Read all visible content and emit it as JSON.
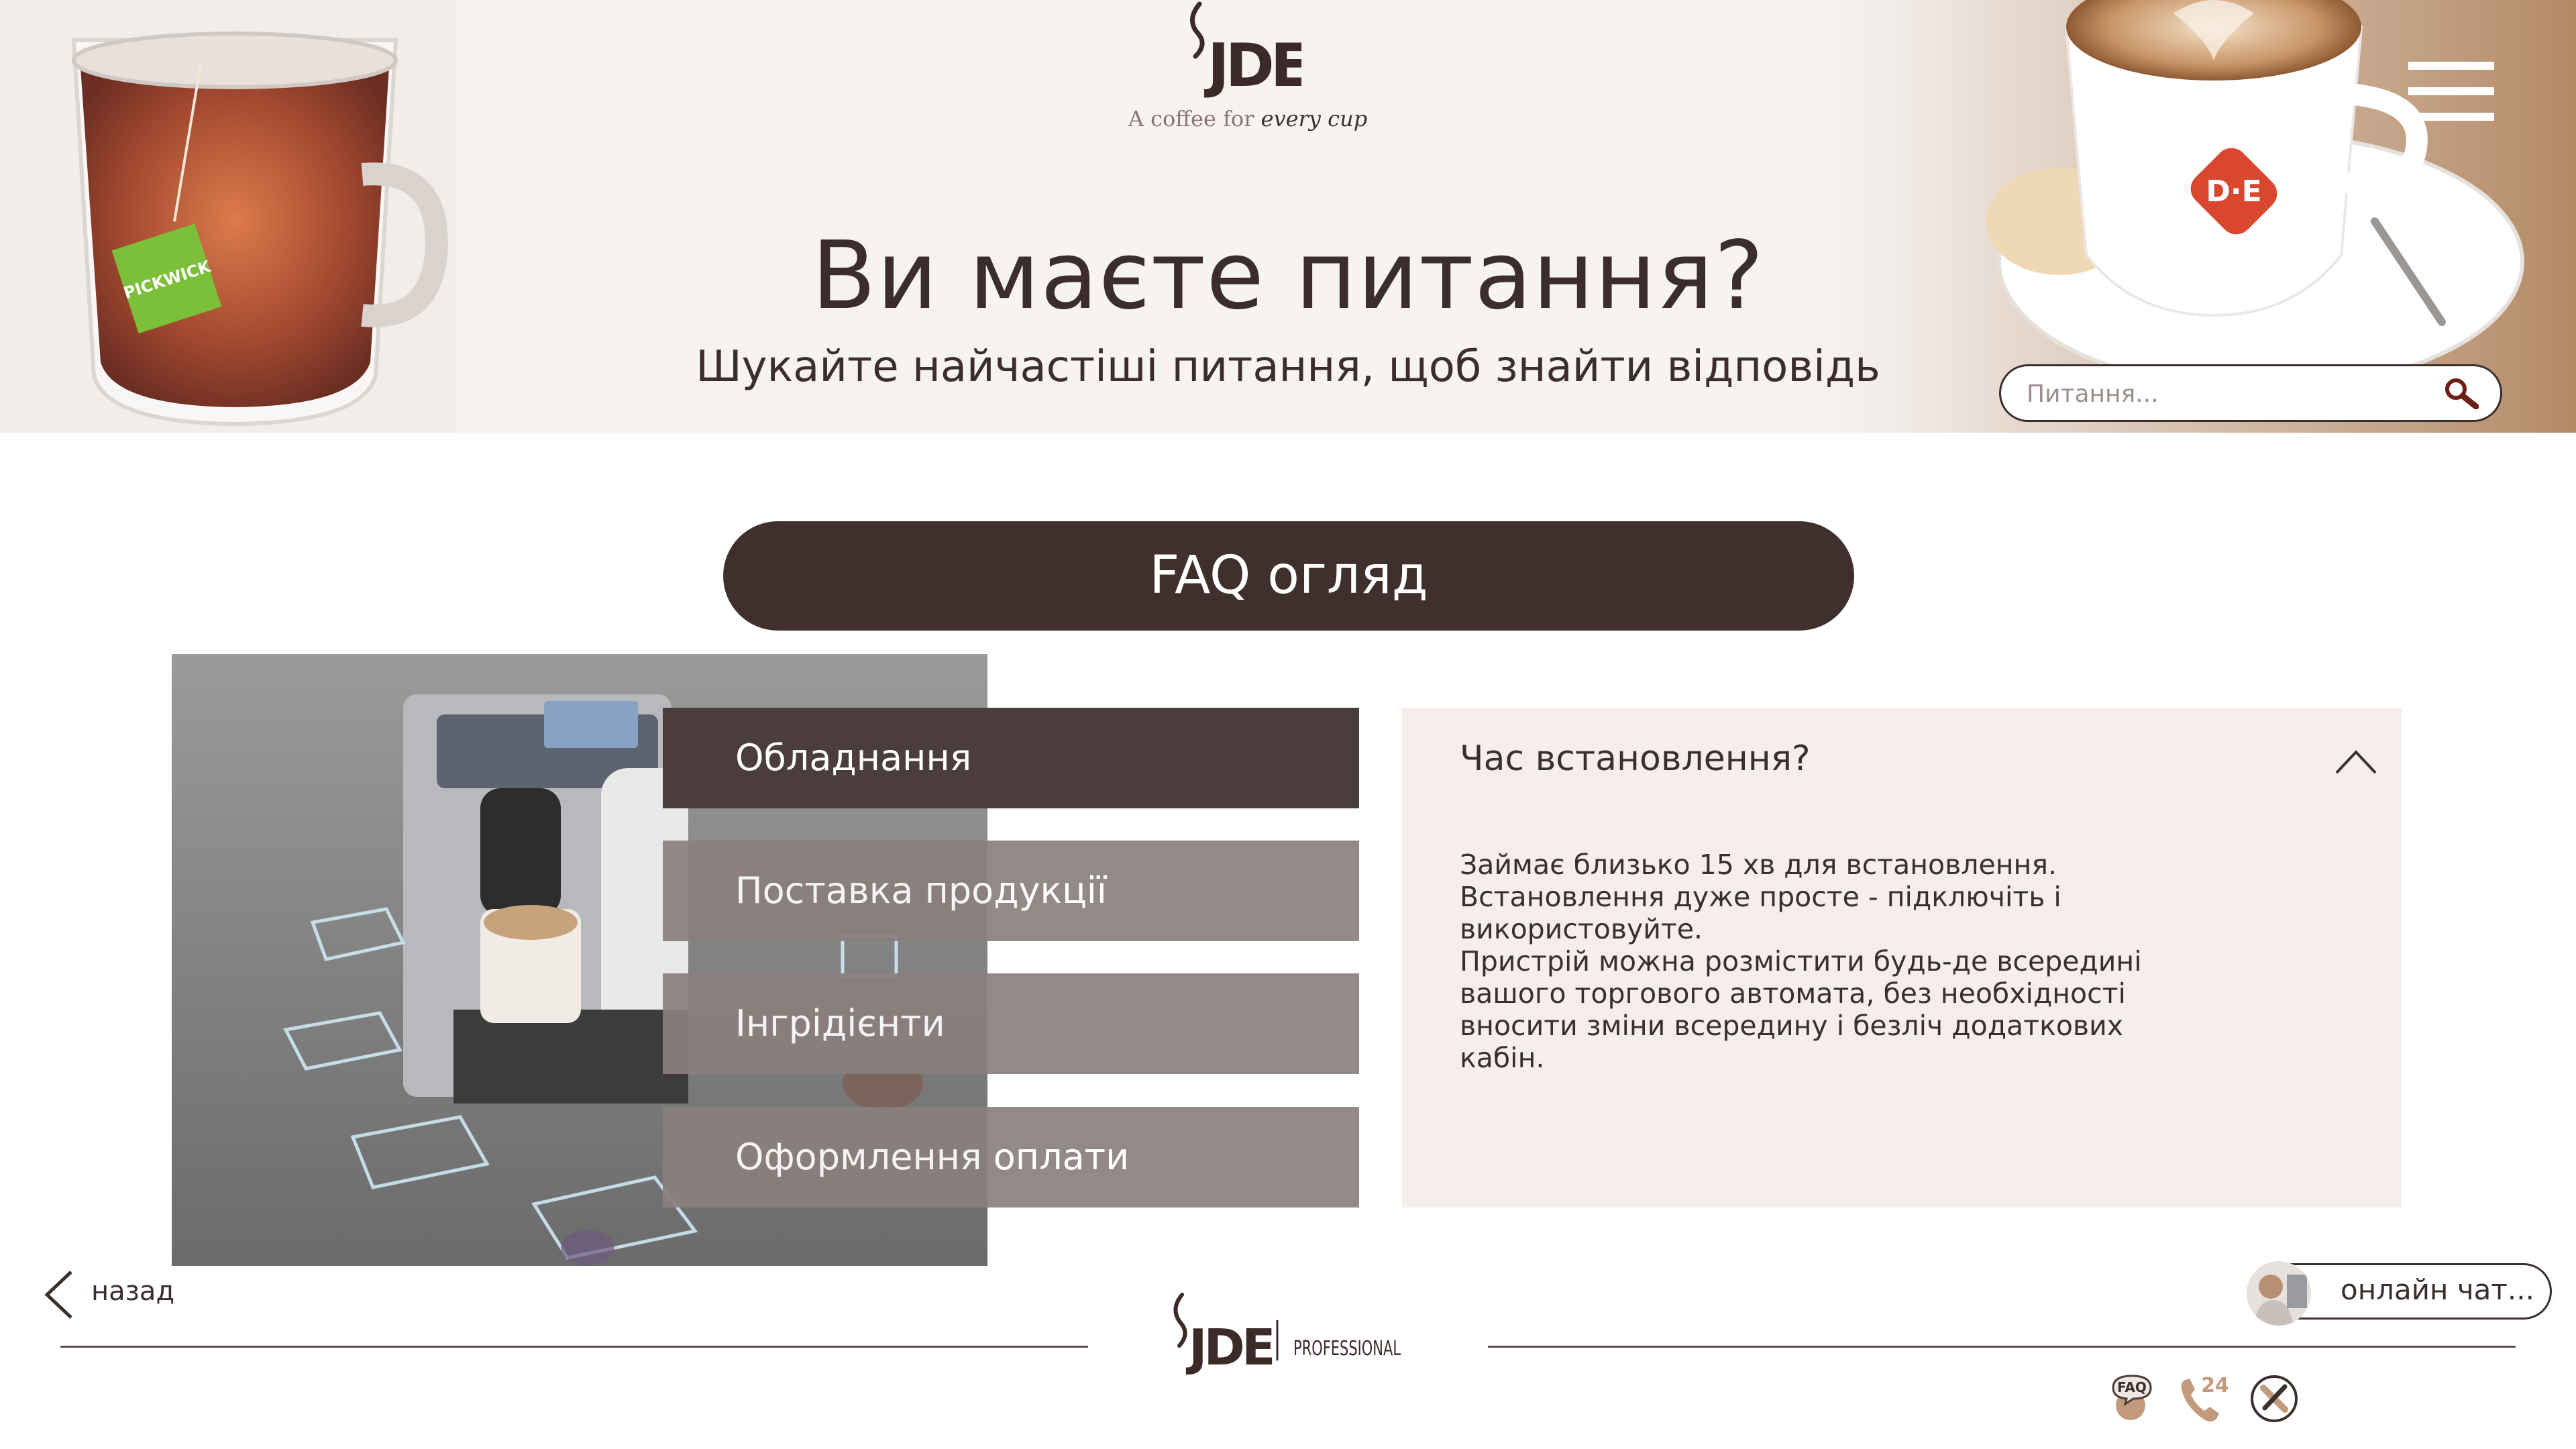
{
  "header": {
    "brand_tagline_plain": "A coffee for",
    "brand_tagline_emph": "every cup",
    "headline": "Ви маєте питання?",
    "subheadline": "Шукайте найчастіші питання, щоб знайти відповідь",
    "tea_tag_text": "PICKWICK",
    "cup_logo_text": "D·E"
  },
  "search": {
    "placeholder": "Питання..."
  },
  "faq_button": {
    "label": "FAQ огляд"
  },
  "categories": [
    {
      "label": "Обладнання",
      "color": "#4b3d3b"
    },
    {
      "label": "Поставка продукції",
      "color": "#8a7f7d"
    },
    {
      "label": "Інгрідієнти",
      "color": "#8a7f7d"
    },
    {
      "label": "Оформлення оплати",
      "color": "#8a7f7d"
    }
  ],
  "answer": {
    "question": "Час встановлення?",
    "lines": [
      "Займає близько 15 хв для встановлення.",
      "Встановлення дуже просте - підключіть і",
      "використовуйте.",
      "Пристрій можна розмістити будь-де всередині",
      "вашого торгового автомата, без необхідності",
      "вносити зміни всередину і безліч додаткових",
      "кабін."
    ]
  },
  "footer": {
    "back_label": "назад",
    "brand_sub": "PROFESSIONAL",
    "chat_label": "онлайн чат...",
    "icons": [
      {
        "name": "faq-icon",
        "label": "FAQ"
      },
      {
        "name": "phone-24-icon",
        "label": "24"
      },
      {
        "name": "service-tools-icon",
        "label": ""
      }
    ]
  },
  "colors": {
    "brand_dark": "#3f2f2d",
    "category_active": "#4b3d3b",
    "category_inactive": "#8a7f7d",
    "answer_panel_bg": "#f5eeea",
    "header_bg": "#f6f3f1",
    "logo_text": "#3b2a27"
  }
}
